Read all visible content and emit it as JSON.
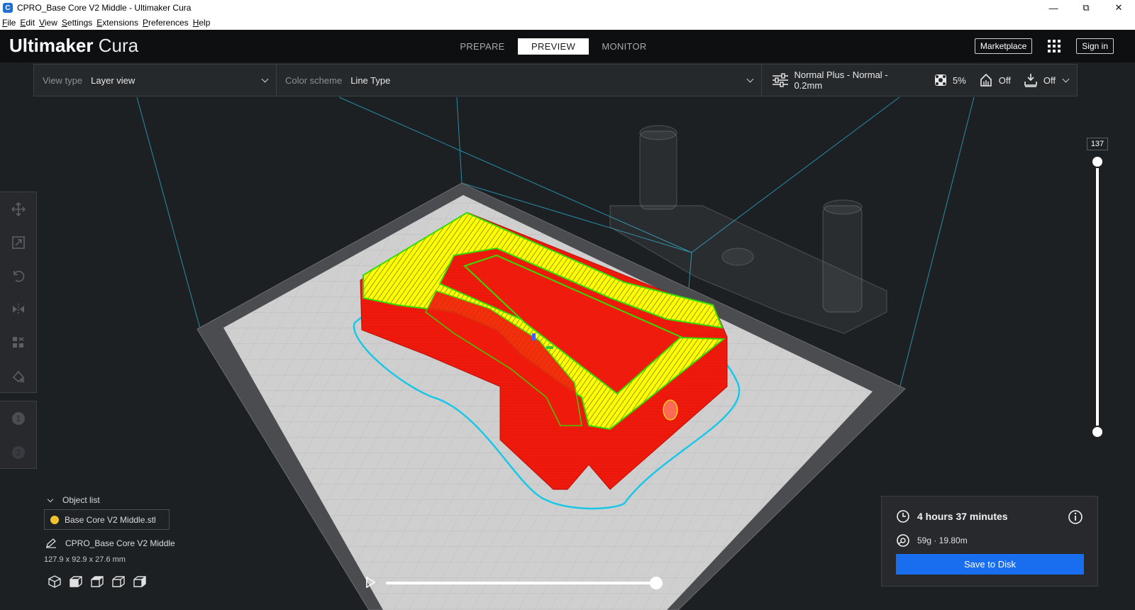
{
  "window": {
    "title": "CPRO_Base Core V2 Middle - Ultimaker Cura"
  },
  "menu": [
    "File",
    "Edit",
    "View",
    "Settings",
    "Extensions",
    "Preferences",
    "Help"
  ],
  "header": {
    "brand_bold": "Ultimaker",
    "brand_light": "Cura",
    "tabs": [
      {
        "label": "PREPARE",
        "active": false
      },
      {
        "label": "PREVIEW",
        "active": true
      },
      {
        "label": "MONITOR",
        "active": false
      }
    ],
    "marketplace": "Marketplace",
    "signin": "Sign in"
  },
  "toolbar": {
    "view_type_label": "View type",
    "view_type_value": "Layer view",
    "color_scheme_label": "Color scheme",
    "color_scheme_value": "Line Type",
    "profile": "Normal Plus - Normal - 0.2mm",
    "infill": "5%",
    "support": "Off",
    "adhesion": "Off"
  },
  "layer_slider": {
    "current_layer": "137"
  },
  "object_list": {
    "header": "Object list",
    "items": [
      {
        "name": "Base Core V2 Middle.stl"
      }
    ],
    "selected_name": "CPRO_Base Core V2 Middle",
    "dimensions": "127.9 x 92.9 x 27.6 mm"
  },
  "print_info": {
    "time": "4 hours 37 minutes",
    "material": "59g · 19.80m",
    "save_label": "Save to Disk"
  },
  "colors": {
    "accent": "#196ef0",
    "wall_outer": "#ff1f10",
    "infill": "#ffff00",
    "inner_wall": "#33dd00",
    "skirt": "#19c8e6"
  }
}
